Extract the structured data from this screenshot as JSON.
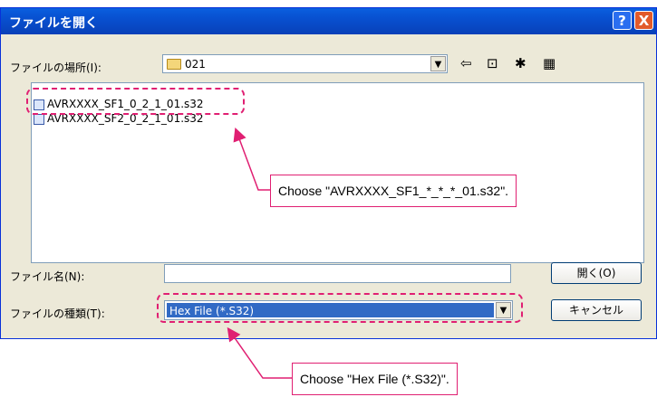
{
  "dialog": {
    "title": "ファイルを開く",
    "help": "?",
    "close": "X"
  },
  "location": {
    "label": "ファイルの場所(I):",
    "value": "021",
    "toolbar": [
      "back-icon",
      "up-folder-icon",
      "new-folder-icon",
      "view-menu-icon"
    ]
  },
  "files": [
    {
      "name": "AVRXXXX_SF1_0_2_1_01.s32"
    },
    {
      "name": "AVRXXXX_SF2_0_2_1_01.s32"
    }
  ],
  "filename": {
    "label": "ファイル名(N):",
    "value": ""
  },
  "filetype": {
    "label": "ファイルの種類(T):",
    "value": "Hex File (*.S32)"
  },
  "buttons": {
    "open": "開く(O)",
    "cancel": "キャンセル"
  },
  "annotations": {
    "file_hint": "Choose  \"AVRXXXX_SF1_*_*_*_01.s32\".",
    "type_hint": "Choose  \"Hex File (*.S32)\"."
  },
  "colors": {
    "accent": "#e01f72",
    "title_bar": "#0a5fdf",
    "selection": "#316ac5"
  }
}
